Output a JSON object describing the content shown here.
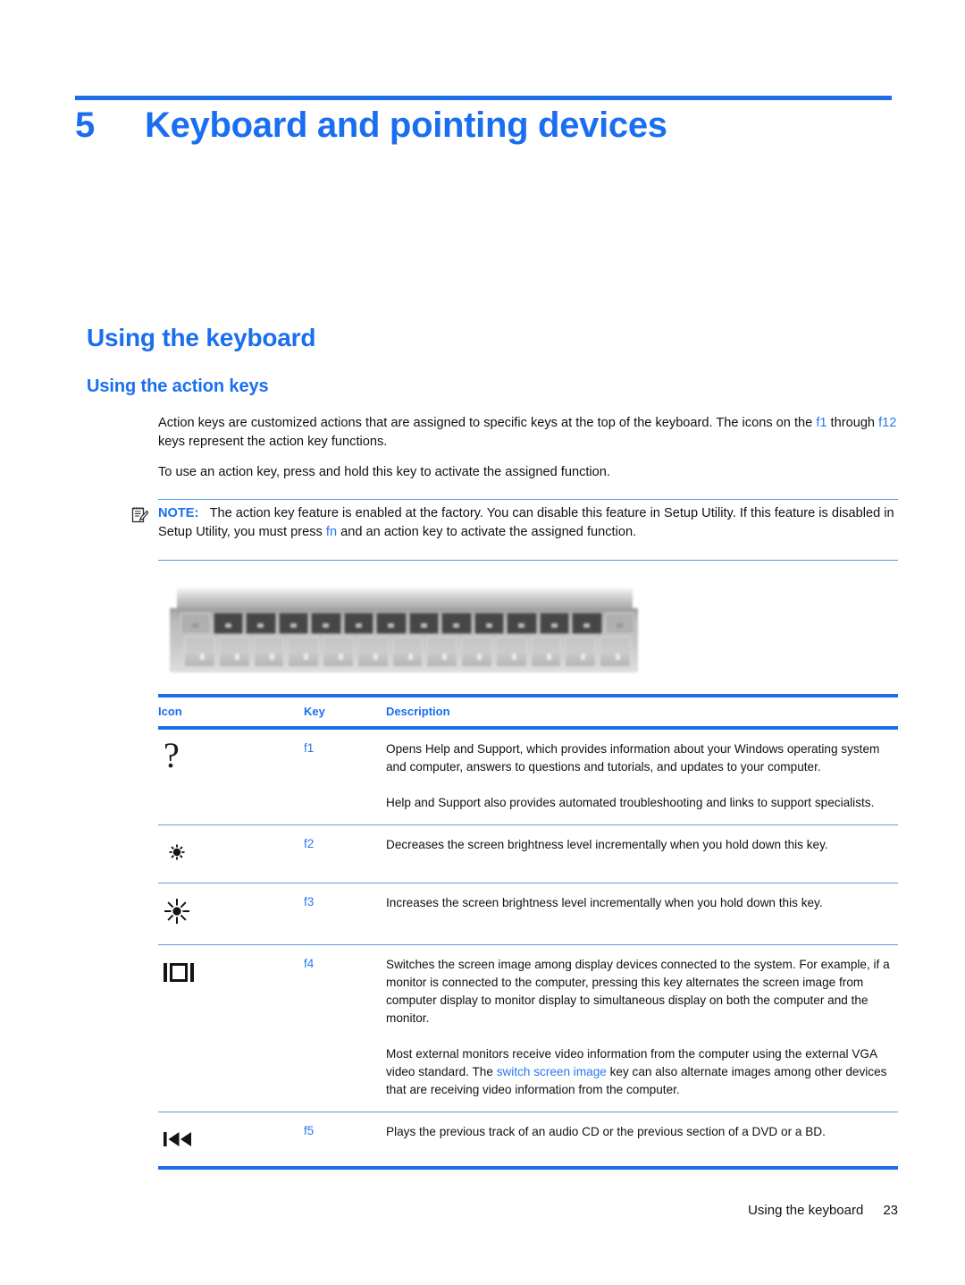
{
  "chapter": {
    "number": "5",
    "title": "Keyboard and pointing devices"
  },
  "headings": {
    "h1": "Using the keyboard",
    "h2": "Using the action keys"
  },
  "paragraphs": {
    "p1_a": "Action keys are customized actions that are assigned to specific keys at the top of the keyboard. The icons on the ",
    "p1_f1": "f1",
    "p1_b": " through ",
    "p1_f12": "f12",
    "p1_c": " keys represent the action key functions.",
    "p2": "To use an action key, press and hold this key to activate the assigned function."
  },
  "note": {
    "label": "NOTE:",
    "text_a": "The action key feature is enabled at the factory. You can disable this feature in Setup Utility. If this feature is disabled in Setup Utility, you must press ",
    "link": "fn",
    "text_b": " and an action key to activate the assigned function."
  },
  "table": {
    "headers": {
      "icon": "Icon",
      "key": "Key",
      "description": "Description"
    },
    "rows": [
      {
        "icon_name": "question-mark-icon",
        "icon_glyph": "?",
        "key": "f1",
        "paragraphs": [
          "Opens Help and Support, which provides information about your Windows operating system and computer, answers to questions and tutorials, and updates to your computer.",
          "Help and Support also provides automated troubleshooting and links to support specialists."
        ]
      },
      {
        "icon_name": "brightness-decrease-icon",
        "icon_glyph": "",
        "key": "f2",
        "paragraphs": [
          "Decreases the screen brightness level incrementally when you hold down this key."
        ]
      },
      {
        "icon_name": "brightness-increase-icon",
        "icon_glyph": "",
        "key": "f3",
        "paragraphs": [
          "Increases the screen brightness level incrementally when you hold down this key."
        ]
      },
      {
        "icon_name": "switch-screen-image-icon",
        "icon_glyph": "",
        "key": "f4",
        "paragraphs": [
          "Switches the screen image among display devices connected to the system. For example, if a monitor is connected to the computer, pressing this key alternates the screen image from computer display to monitor display to simultaneous display on both the computer and the monitor.",
          "MOST_EXTERNAL_SPLIT"
        ],
        "p2_a": "Most external monitors receive video information from the computer using the external VGA video standard. The ",
        "p2_link": "switch screen image",
        "p2_b": " key can also alternate images among other devices that are receiving video information from the computer."
      },
      {
        "icon_name": "previous-track-icon",
        "icon_glyph": "",
        "key": "f5",
        "paragraphs": [
          "Plays the previous track of an audio CD or the previous section of a DVD or a BD."
        ]
      }
    ]
  },
  "footer": {
    "section": "Using the keyboard",
    "page": "23"
  },
  "colors": {
    "accent_blue": "#1a6ef0",
    "rule_blue": "#1c6fe8",
    "link_blue": "#2878f0",
    "thin_rule": "#5a9ae8",
    "body_text": "#111111"
  },
  "keyboard_image": {
    "alt": "Photo of laptop keyboard top row showing action keys above the number row"
  }
}
